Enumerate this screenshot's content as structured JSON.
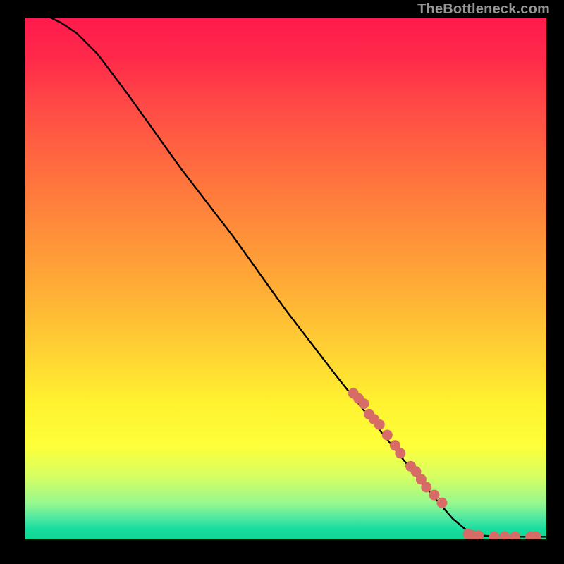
{
  "watermark": "TheBottleneck.com",
  "chart_data": {
    "type": "line",
    "title": "",
    "xlabel": "",
    "ylabel": "",
    "xlim": [
      0,
      100
    ],
    "ylim": [
      0,
      100
    ],
    "grid": false,
    "series": [
      {
        "name": "curve",
        "style": "solid-black",
        "points": [
          {
            "x": 5,
            "y": 100
          },
          {
            "x": 7,
            "y": 99
          },
          {
            "x": 10,
            "y": 97
          },
          {
            "x": 14,
            "y": 93
          },
          {
            "x": 20,
            "y": 85
          },
          {
            "x": 30,
            "y": 71
          },
          {
            "x": 40,
            "y": 58
          },
          {
            "x": 50,
            "y": 44
          },
          {
            "x": 60,
            "y": 31
          },
          {
            "x": 68,
            "y": 21
          },
          {
            "x": 76,
            "y": 11
          },
          {
            "x": 82,
            "y": 4
          },
          {
            "x": 85,
            "y": 1.5
          },
          {
            "x": 88,
            "y": 0.7
          },
          {
            "x": 92,
            "y": 0.5
          },
          {
            "x": 96,
            "y": 0.5
          },
          {
            "x": 100,
            "y": 0.5
          }
        ]
      },
      {
        "name": "highlight-dots",
        "style": "salmon-dots",
        "points": [
          {
            "x": 63,
            "y": 28
          },
          {
            "x": 64,
            "y": 27
          },
          {
            "x": 65,
            "y": 26
          },
          {
            "x": 66,
            "y": 24
          },
          {
            "x": 67,
            "y": 23
          },
          {
            "x": 68,
            "y": 22
          },
          {
            "x": 69.5,
            "y": 20
          },
          {
            "x": 71,
            "y": 18
          },
          {
            "x": 72,
            "y": 16.5
          },
          {
            "x": 74,
            "y": 14
          },
          {
            "x": 75,
            "y": 13
          },
          {
            "x": 76,
            "y": 11.5
          },
          {
            "x": 77,
            "y": 10
          },
          {
            "x": 78.5,
            "y": 8.5
          },
          {
            "x": 80,
            "y": 7
          },
          {
            "x": 85,
            "y": 1
          },
          {
            "x": 86,
            "y": 0.7
          },
          {
            "x": 87,
            "y": 0.7
          },
          {
            "x": 90,
            "y": 0.5
          },
          {
            "x": 92,
            "y": 0.5
          },
          {
            "x": 94,
            "y": 0.5
          },
          {
            "x": 97,
            "y": 0.5
          },
          {
            "x": 98,
            "y": 0.5
          }
        ]
      }
    ],
    "colors": {
      "curve": "#000000",
      "dots": "#d76b66",
      "gradient_top": "#ff1a4d",
      "gradient_bottom": "#0ed894",
      "background": "#000000"
    }
  }
}
